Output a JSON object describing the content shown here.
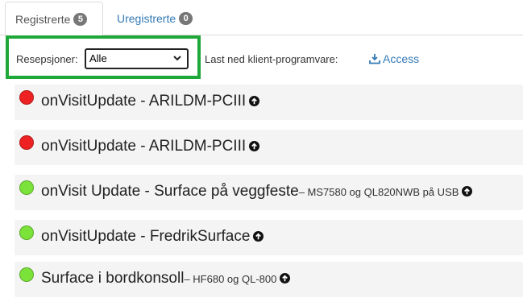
{
  "tabs": [
    {
      "label": "Registrerte",
      "count": "5"
    },
    {
      "label": "Uregistrerte",
      "count": "0"
    }
  ],
  "filter": {
    "label": "Resepsjoner:",
    "selected": "Alle",
    "download_label": "Last ned klient-programvare:",
    "access_label": "Access"
  },
  "colors": {
    "online": "#7be23a",
    "offline": "#ee2222",
    "link": "#337ab7",
    "highlight": "#1fa83a"
  },
  "items": [
    {
      "title": "onVisitUpdate - ARILDM-PCIII",
      "subtitle": "",
      "status": "offline"
    },
    {
      "title": "onVisitUpdate - ARILDM-PCIII",
      "subtitle": "",
      "status": "offline"
    },
    {
      "title": "onVisit Update - Surface på veggfeste",
      "subtitle": "– MS7580 og QL820NWB på USB",
      "status": "online"
    },
    {
      "title": "onVisitUpdate - FredrikSurface",
      "subtitle": "",
      "status": "online"
    },
    {
      "title": "Surface i bordkonsoll",
      "subtitle": "– HF680 og QL-800",
      "status": "online"
    }
  ]
}
